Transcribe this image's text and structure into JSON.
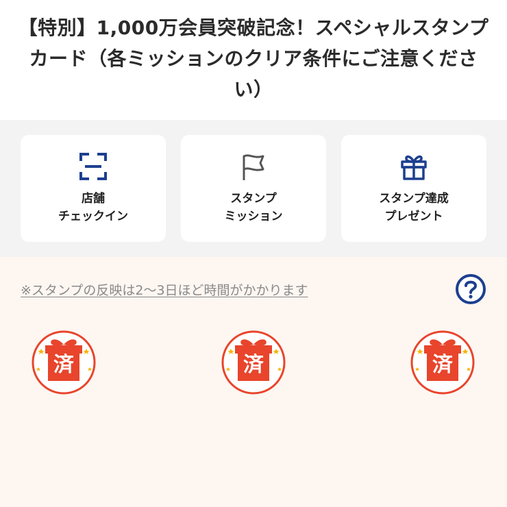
{
  "header": {
    "title": "【特別】1,000万会員突破記念！スペシャルスタンプカード（各ミッションのクリア条件にご注意ください）"
  },
  "menu": {
    "items": [
      {
        "line1": "店舗",
        "line2": "チェックイン",
        "icon": "scan-frame-icon"
      },
      {
        "line1": "スタンプ",
        "line2": "ミッション",
        "icon": "flag-icon"
      },
      {
        "line1": "スタンプ達成",
        "line2": "プレゼント",
        "icon": "gift-icon"
      }
    ]
  },
  "stamp_card": {
    "notice": "※スタンプの反映は2〜3日ほど時間がかかります",
    "help_icon": "question-circle-icon",
    "stamps": [
      {
        "label": "済",
        "icon": "gift-stamp-icon"
      },
      {
        "label": "済",
        "icon": "gift-stamp-icon"
      },
      {
        "label": "済",
        "icon": "gift-stamp-icon"
      }
    ]
  },
  "colors": {
    "accent_blue": "#1d3f8f",
    "stamp_red": "#e8452c",
    "stamp_background": "#fdf6f1",
    "menu_background": "#f3f3f3"
  }
}
